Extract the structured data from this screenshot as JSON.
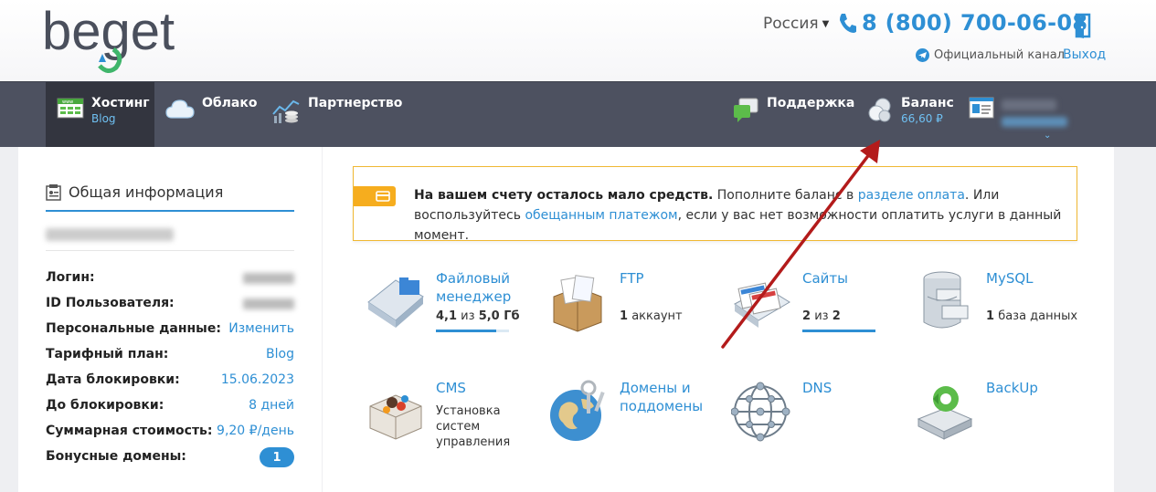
{
  "header": {
    "logo_text": "beget",
    "region": "Россия",
    "phone": "8 (800) 700-06-08",
    "channel_label": "Официальный канал",
    "logout_label": "Выход"
  },
  "nav": {
    "hosting": {
      "label": "Хостинг",
      "sub": "Blog"
    },
    "cloud": {
      "label": "Облако"
    },
    "partner": {
      "label": "Партнерство"
    },
    "support": {
      "label": "Поддержка"
    },
    "balance": {
      "label": "Баланс",
      "value": "66,60 ₽"
    }
  },
  "sidebar": {
    "title": "Общая информация",
    "rows": [
      {
        "label": "Логин:",
        "value": ""
      },
      {
        "label": "ID Пользователя:",
        "value": ""
      },
      {
        "label": "Персональные данные:",
        "value": "Изменить"
      },
      {
        "label": "Тарифный план:",
        "value": "Blog"
      },
      {
        "label": "Дата блокировки:",
        "value": "15.06.2023"
      },
      {
        "label": "До блокировки:",
        "value": "8 дней"
      },
      {
        "label": "Суммарная стоимость:",
        "value": "9,20 ₽/день"
      },
      {
        "label": "Бонусные домены:",
        "value": "1"
      }
    ]
  },
  "alert": {
    "bold": "На вашем счету осталось мало средств.",
    "t1": " Пополните баланс в ",
    "link1": "разделе оплата",
    "t2": ". Или воспользуйтесь ",
    "link2": "обещанным платежом",
    "t3": ", если у вас нет возможности оплатить услуги в данный момент."
  },
  "tiles": {
    "files": {
      "name": "Файловый менеджер",
      "used": "4,1",
      "of": "из",
      "total": "5,0 Гб",
      "usage_fraction": 0.82
    },
    "ftp": {
      "name": "FTP",
      "count": "1",
      "unit": "аккаунт"
    },
    "sites": {
      "name": "Сайты",
      "used": "2",
      "of": "из",
      "total": "2",
      "usage_fraction": 1.0
    },
    "mysql": {
      "name": "MySQL",
      "count": "1",
      "unit": "база данных"
    },
    "cms": {
      "name": "CMS",
      "desc": "Установка систем управления"
    },
    "domains": {
      "name": "Домены и поддомены"
    },
    "dns": {
      "name": "DNS"
    },
    "backup": {
      "name": "BackUp"
    }
  },
  "colors": {
    "accent": "#2e8fd4",
    "nav_bg": "#4d5160",
    "warning": "#f6ad1e",
    "arrow": "#b31b1b"
  }
}
